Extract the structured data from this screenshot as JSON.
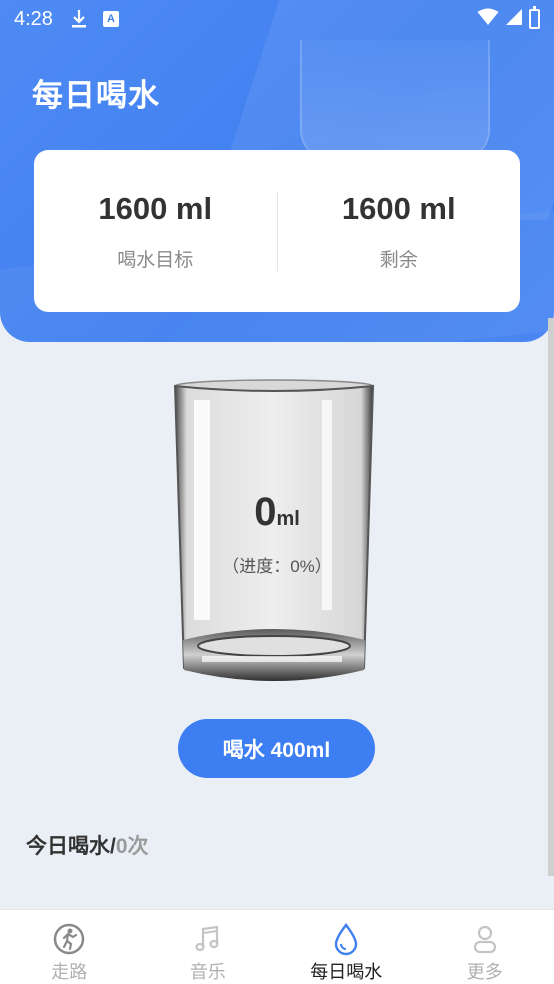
{
  "status_bar": {
    "time": "4:28",
    "left_icons": [
      "download-icon",
      "a-icon"
    ],
    "right_icons": [
      "wifi-icon",
      "signal-icon",
      "battery-icon"
    ],
    "a_icon_text": "A"
  },
  "header": {
    "title": "每日喝水"
  },
  "stats": {
    "goal_value": "1600 ml",
    "goal_label": "喝水目标",
    "remaining_value": "1600 ml",
    "remaining_label": "剩余"
  },
  "glass": {
    "amount": "0",
    "unit": "ml",
    "progress_text": "（进度：0%）",
    "fill_fraction": 0
  },
  "drink_button": {
    "label": "喝水 400ml"
  },
  "today": {
    "label": "今日喝水/",
    "count": "0次"
  },
  "nav": {
    "items": [
      {
        "label": "走路",
        "icon": "walk-icon",
        "active": false
      },
      {
        "label": "音乐",
        "icon": "music-note-icon",
        "active": false
      },
      {
        "label": "每日喝水",
        "icon": "water-drop-icon",
        "active": true
      },
      {
        "label": "更多",
        "icon": "person-icon",
        "active": false
      }
    ]
  },
  "colors": {
    "primary": "#3f7ff0",
    "background": "#eaeff6",
    "text_dark": "#333333",
    "text_muted": "#8a8a8a"
  }
}
